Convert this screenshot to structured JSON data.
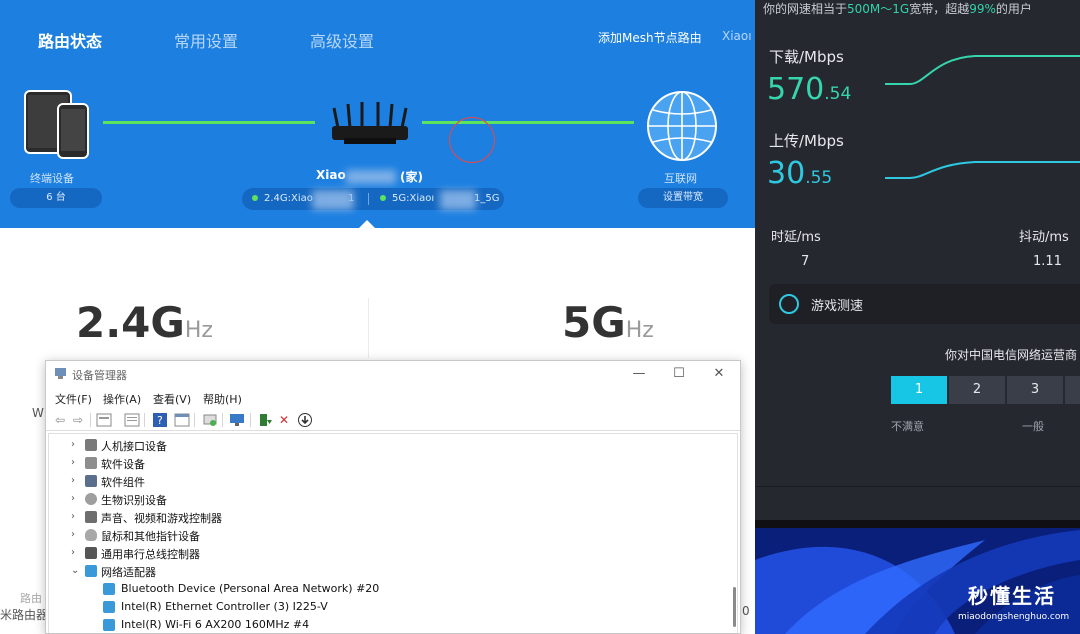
{
  "router": {
    "tabs": [
      "路由状态",
      "常用设置",
      "高级设置"
    ],
    "add_mesh": "添加Mesh节点路由",
    "header_right": "Xiaoı",
    "devices_label": "终端设备",
    "devices_count": "6 台",
    "router_name": "Xiao",
    "router_name_suffix": "(家)",
    "wifi_24": "2.4G:Xiao",
    "wifi_24_tail": "1",
    "wifi_5": "5G:Xiaoı",
    "wifi_5_tail": "1_5G",
    "internet_label": "互联网",
    "bandwidth_button": "设置带宽",
    "freq_24": "2.4G",
    "freq_5": "5G",
    "freq_unit": "Hz",
    "partial_left_1": "W",
    "partial_left_2": "路由",
    "partial_left_3": "米路由器",
    "partial_right_num": "0",
    "colors": {
      "header_bg": "#1d7fe0",
      "link_line": "#5ee35e"
    }
  },
  "device_manager": {
    "title": "设备管理器",
    "window_buttons": {
      "minimize": "—",
      "maximize": "☐",
      "close": "✕"
    },
    "menu": [
      "文件(F)",
      "操作(A)",
      "查看(V)",
      "帮助(H)"
    ],
    "toolbar_icons": [
      "back-icon",
      "forward-icon",
      "properties-icon",
      "list-icon",
      "help-icon",
      "view-icon",
      "scan-icon",
      "monitor-icon",
      "driver-update-icon",
      "uninstall-icon",
      "download-icon"
    ],
    "tree": [
      {
        "label": "人机接口设备",
        "expanded": false,
        "icon": "hid-icon"
      },
      {
        "label": "软件设备",
        "expanded": false,
        "icon": "software-device-icon"
      },
      {
        "label": "软件组件",
        "expanded": false,
        "icon": "software-component-icon"
      },
      {
        "label": "生物识别设备",
        "expanded": false,
        "icon": "biometric-icon"
      },
      {
        "label": "声音、视频和游戏控制器",
        "expanded": false,
        "icon": "audio-icon"
      },
      {
        "label": "鼠标和其他指针设备",
        "expanded": false,
        "icon": "mouse-icon"
      },
      {
        "label": "通用串行总线控制器",
        "expanded": false,
        "icon": "usb-icon"
      },
      {
        "label": "网络适配器",
        "expanded": true,
        "icon": "network-adapter-icon"
      }
    ],
    "adapters": [
      "Bluetooth Device (Personal Area Network) #20",
      "Intel(R) Ethernet Controller (3) I225-V",
      "Intel(R) Wi-Fi 6 AX200 160MHz #4"
    ]
  },
  "speed_test": {
    "banner_prefix": "你的网速相当于",
    "banner_range": "500M～1G",
    "banner_mid": "宽带，超越",
    "banner_pct": "99%",
    "banner_suffix": "的用户",
    "download_label": "下载/Mbps",
    "download_int": "570",
    "download_dec": ".54",
    "upload_label": "上传/Mbps",
    "upload_int": "30",
    "upload_dec": ".55",
    "latency_label": "时延/ms",
    "latency_value": "7",
    "jitter_label": "抖动/ms",
    "jitter_value": "1.11",
    "game_test": "游戏测速",
    "survey_question": "你对中国电信网络运营商",
    "ratings": [
      "1",
      "2",
      "3"
    ],
    "selected_rating": "1",
    "caption_low": "不满意",
    "caption_mid": "一般",
    "colors": {
      "panel_bg": "#25282f",
      "download": "#35d6ad",
      "upload": "#2ec8e0"
    }
  },
  "watermark": {
    "title": "秒懂生活",
    "url": "miaodongshenghuo.com"
  }
}
